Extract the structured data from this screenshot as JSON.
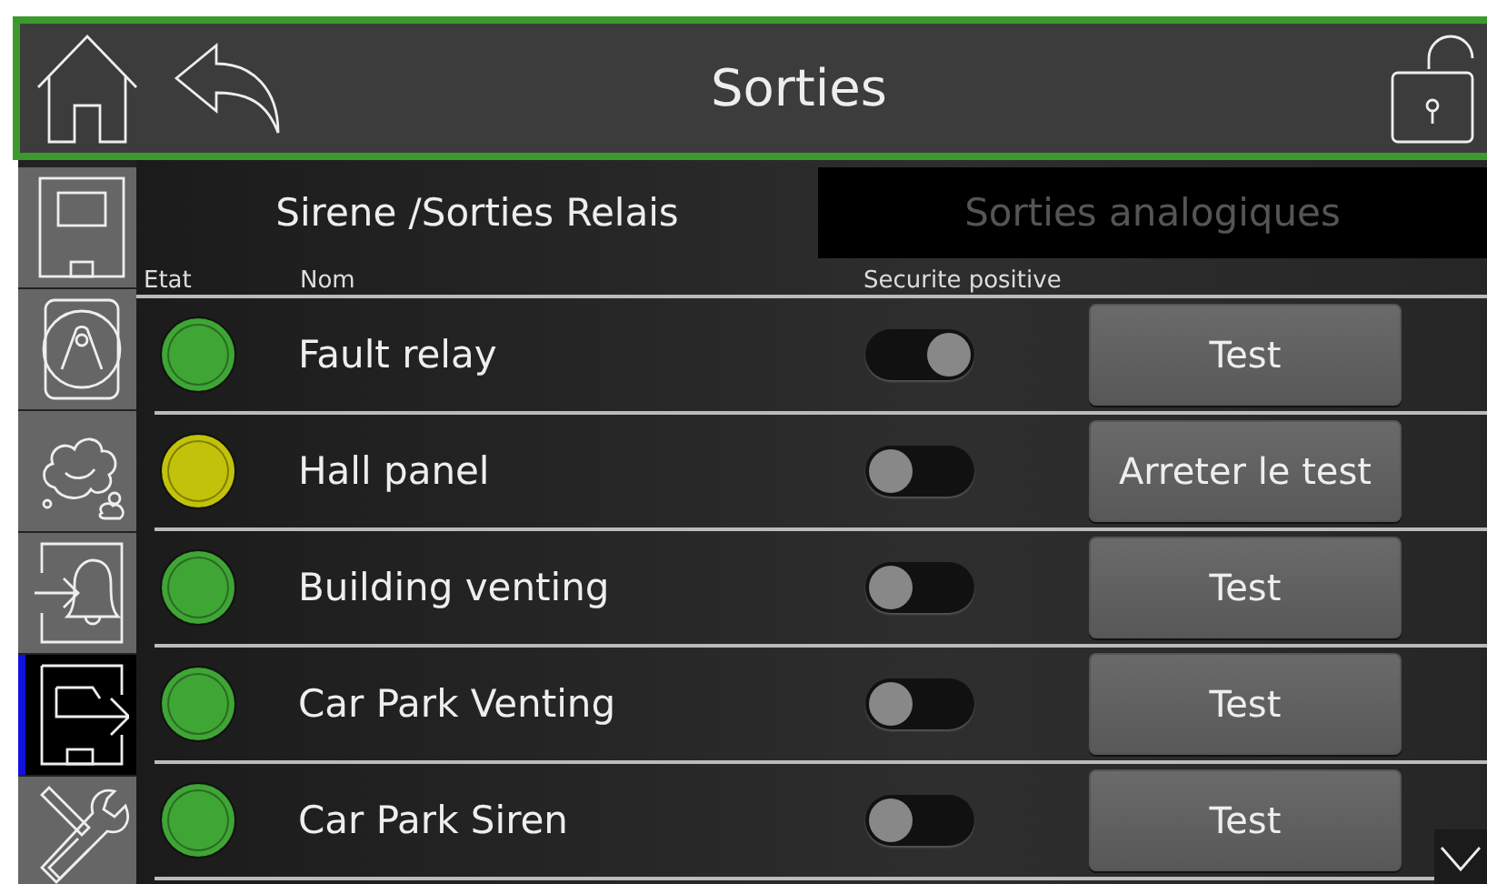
{
  "header": {
    "title": "Sorties"
  },
  "sidebar": {
    "items": [
      {
        "kind": "panel",
        "selected": false
      },
      {
        "kind": "detector",
        "selected": false
      },
      {
        "kind": "smoke",
        "selected": false
      },
      {
        "kind": "bell-input",
        "selected": false
      },
      {
        "kind": "output",
        "selected": true
      },
      {
        "kind": "tools",
        "selected": false
      }
    ]
  },
  "tabs": [
    {
      "label": "Sirene /Sorties Relais",
      "selected": true
    },
    {
      "label": "Sorties analogiques",
      "selected": false
    }
  ],
  "columns": {
    "state": "Etat",
    "name": "Nom",
    "positive": "Securite positive"
  },
  "rows": [
    {
      "color": "#3fa535",
      "name": "Fault relay",
      "on": true,
      "button": "Test"
    },
    {
      "color": "#c2c20a",
      "name": "Hall panel",
      "on": false,
      "button": "Arreter le test"
    },
    {
      "color": "#3fa535",
      "name": "Building venting",
      "on": false,
      "button": "Test"
    },
    {
      "color": "#3fa535",
      "name": "Car Park Venting",
      "on": false,
      "button": "Test"
    },
    {
      "color": "#3fa535",
      "name": "Car Park Siren",
      "on": false,
      "button": "Test"
    }
  ]
}
